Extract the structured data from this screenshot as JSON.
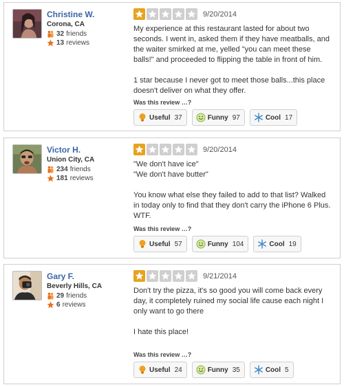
{
  "was_label": "Was this review …?",
  "colors": {
    "star_on": "#e7a31f",
    "star_off": "#cfcfcf",
    "name": "#3b65a7"
  },
  "reviews": [
    {
      "user": {
        "name": "Christine W.",
        "location": "Corona, CA",
        "friends": "32",
        "friends_label": "friends",
        "reviews": "13",
        "reviews_label": "reviews"
      },
      "rating": 1,
      "date": "9/20/2014",
      "paragraphs": [
        "My experience at this restaurant lasted for about two seconds. I went in, asked them if they have meatballs, and the waiter smirked at me, yelled \"you can meet these balls!\" and proceeded to flipping the table in front of him.",
        "1 star because I never got to meet those balls...this place doesn't deliver on what they offer."
      ],
      "votes": {
        "useful_label": "Useful",
        "useful": "37",
        "funny_label": "Funny",
        "funny": "97",
        "cool_label": "Cool",
        "cool": "17"
      }
    },
    {
      "user": {
        "name": "Victor H.",
        "location": "Union City, CA",
        "friends": "234",
        "friends_label": "friends",
        "reviews": "181",
        "reviews_label": "reviews"
      },
      "rating": 1,
      "date": "9/20/2014",
      "paragraphs": [
        "\"We don't have ice\"\n\"We don't have butter\"",
        "You know what else they failed to add to that list? Walked in today only to find that they don't carry the iPhone 6 Plus. WTF."
      ],
      "votes": {
        "useful_label": "Useful",
        "useful": "57",
        "funny_label": "Funny",
        "funny": "104",
        "cool_label": "Cool",
        "cool": "19"
      }
    },
    {
      "user": {
        "name": "Gary F.",
        "location": "Beverly Hills, CA",
        "friends": "29",
        "friends_label": "friends",
        "reviews": "6",
        "reviews_label": "reviews"
      },
      "rating": 1,
      "date": "9/21/2014",
      "paragraphs": [
        "Don't try the pizza, it's so good you will come back every day, it completely ruined my social life cause each night I only want to go there",
        "I hate this place!"
      ],
      "votes": {
        "useful_label": "Useful",
        "useful": "24",
        "funny_label": "Funny",
        "funny": "35",
        "cool_label": "Cool",
        "cool": "5"
      }
    }
  ]
}
